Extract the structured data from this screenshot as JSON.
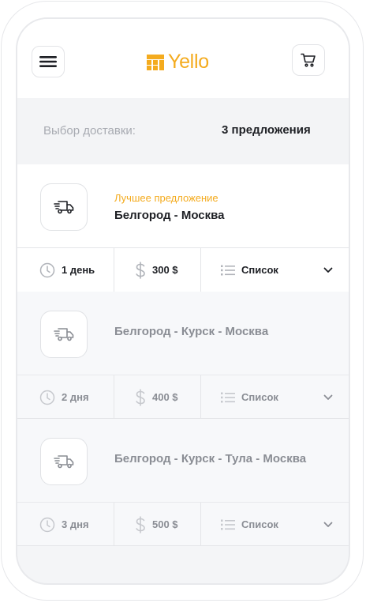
{
  "header": {
    "brand_name": "Yello",
    "menu_icon": "hamburger-menu-icon",
    "cart_icon": "shopping-cart-icon",
    "brand_color": "#f4ab1e"
  },
  "summary": {
    "label": "Выбор доставки:",
    "count": "3 предложения"
  },
  "offers": [
    {
      "badge": "Лучшее предложение",
      "route": "Белгород - Москва",
      "duration": "1 день",
      "price": "300 $",
      "list_label": "Список",
      "active": true
    },
    {
      "route": "Белгород - Курск - Москва",
      "duration": "2 дня",
      "price": "400 $",
      "list_label": "Список",
      "active": false
    },
    {
      "route": "Белгород - Курск - Тула - Москва",
      "duration": "3 дня",
      "price": "500 $",
      "list_label": "Список",
      "active": false
    }
  ]
}
